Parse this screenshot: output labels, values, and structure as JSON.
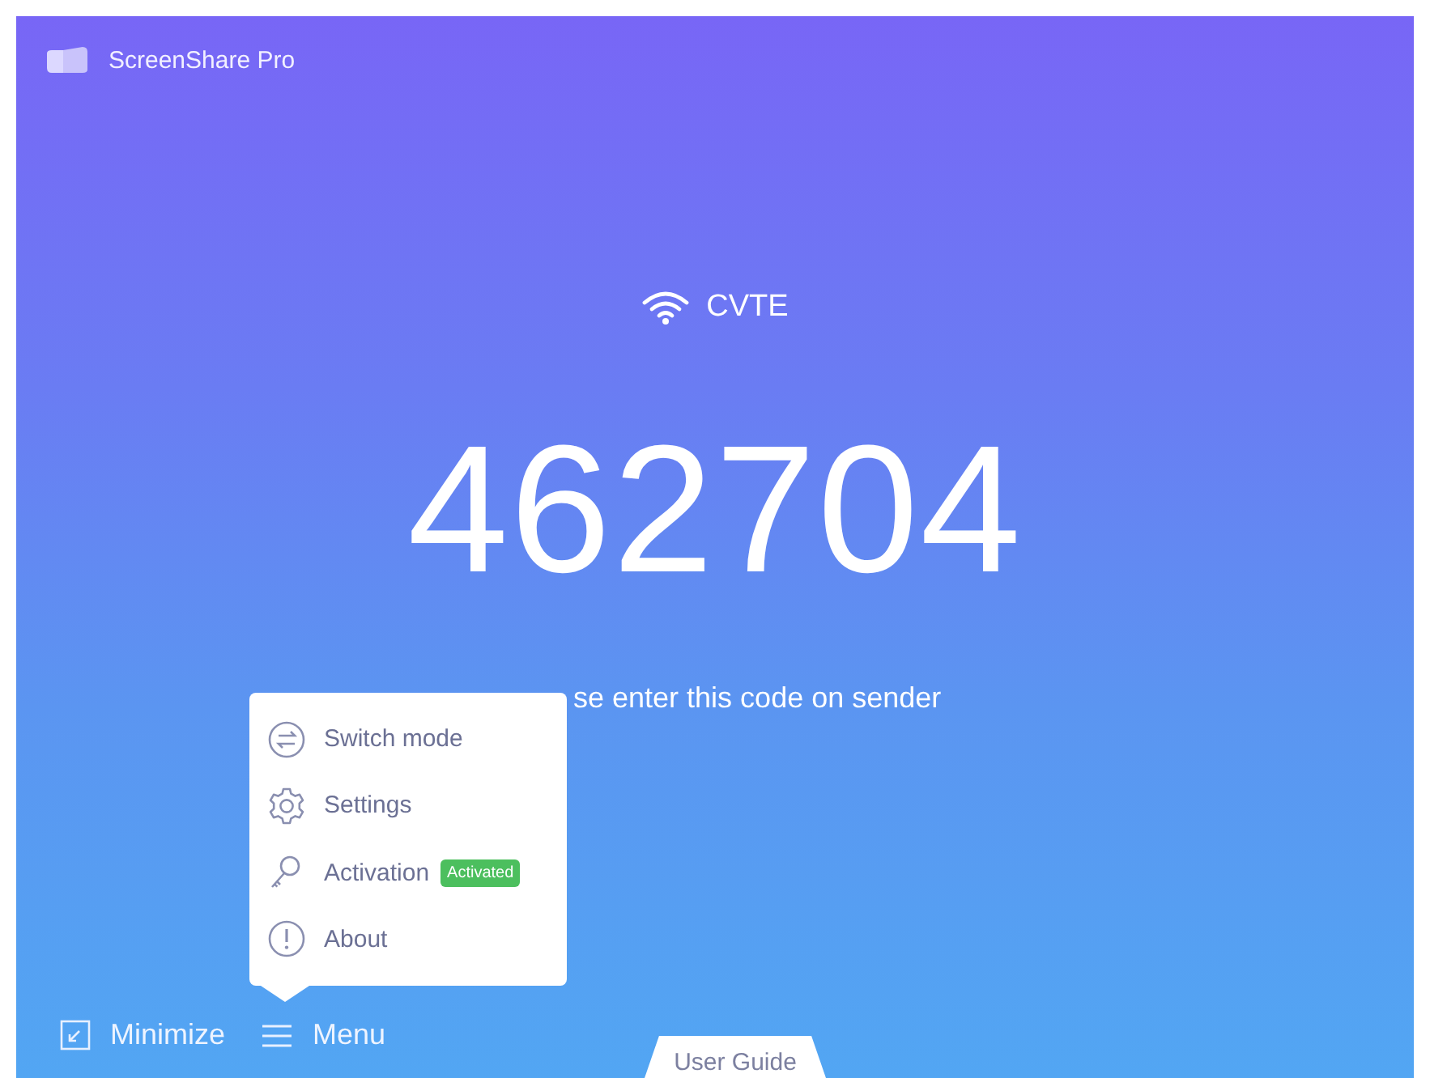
{
  "app": {
    "title": "ScreenShare Pro"
  },
  "network": {
    "name": "CVTE"
  },
  "code": "462704",
  "hint": "se enter this code on sender",
  "menu": {
    "items": [
      {
        "kind": "switch",
        "label": "Switch mode"
      },
      {
        "kind": "settings",
        "label": "Settings"
      },
      {
        "kind": "activation",
        "label": "Activation",
        "badge": "Activated"
      },
      {
        "kind": "about",
        "label": "About"
      }
    ]
  },
  "bottom_bar": {
    "minimize": "Minimize",
    "menu": "Menu"
  },
  "user_guide": "User Guide"
}
